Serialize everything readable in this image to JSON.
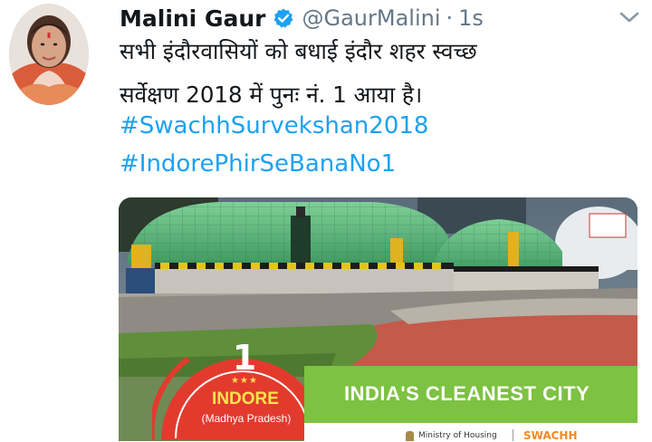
{
  "tweet": {
    "author_name": "Malini Gaur",
    "handle": "@GaurMalini",
    "separator": "·",
    "time": "1s",
    "text_line1": "सभी इंदौरवासियों को बधाई इंदौर शहर स्वच्छ",
    "text_line2": "सर्वेक्षण 2018 में पुनः नं. 1 आया है।",
    "hashtags": [
      "#SwachhSurvekshan2018",
      "#IndorePhirSeBanaNo1"
    ]
  },
  "media": {
    "rank": "1",
    "stars": "★★★",
    "city": "INDORE",
    "state": "(Madhya Pradesh)",
    "banner": "INDIA'S CLEANEST CITY",
    "ministry": "Ministry of Housing",
    "brand": "SWACHH"
  },
  "colors": {
    "verified": "#1da1f2",
    "link": "#1da1f2",
    "muted": "#657786",
    "badge_red": "#e23b2e",
    "banner_green": "#7dc242"
  },
  "icons": [
    "verified-badge-icon",
    "chevron-down-icon"
  ]
}
